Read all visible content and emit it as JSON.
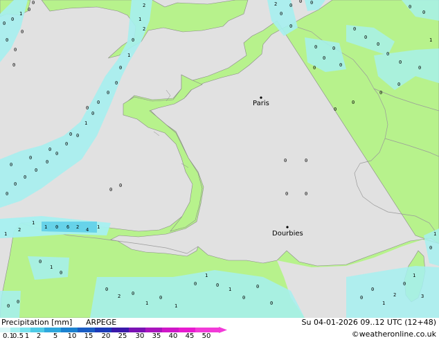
{
  "map": {
    "colors": {
      "sea": "#e1e1e1",
      "land": "#b7f28c",
      "border": "#9a9a9a",
      "coast": "#888888",
      "precip_light": "#a6f0f0",
      "precip_medium": "#5fcfe9"
    },
    "cities": [
      {
        "name": "Paris",
        "value": "Paris"
      },
      {
        "name": "Dourbies",
        "value": "Dourbies"
      }
    ]
  },
  "footer": {
    "title": "Precipitation [mm]",
    "model": "ARPEGE",
    "datetime": "Su 04-01-2026 09..12 UTC (12+48)",
    "credit": "©weatheronline.co.uk",
    "scale_labels": [
      "0.1",
      "0.5",
      "1",
      "2",
      "5",
      "10",
      "15",
      "20",
      "25",
      "30",
      "35",
      "40",
      "45",
      "50"
    ],
    "scale_colors": [
      "#d8f8f8",
      "#a6f0f0",
      "#7be3ee",
      "#4fcbe6",
      "#2ea7dd",
      "#1c82d0",
      "#1a5cc4",
      "#1b3ab8",
      "#3a18aa",
      "#7a12b4",
      "#a814bd",
      "#cf16c8",
      "#e81ad0",
      "#f23ad8"
    ]
  }
}
